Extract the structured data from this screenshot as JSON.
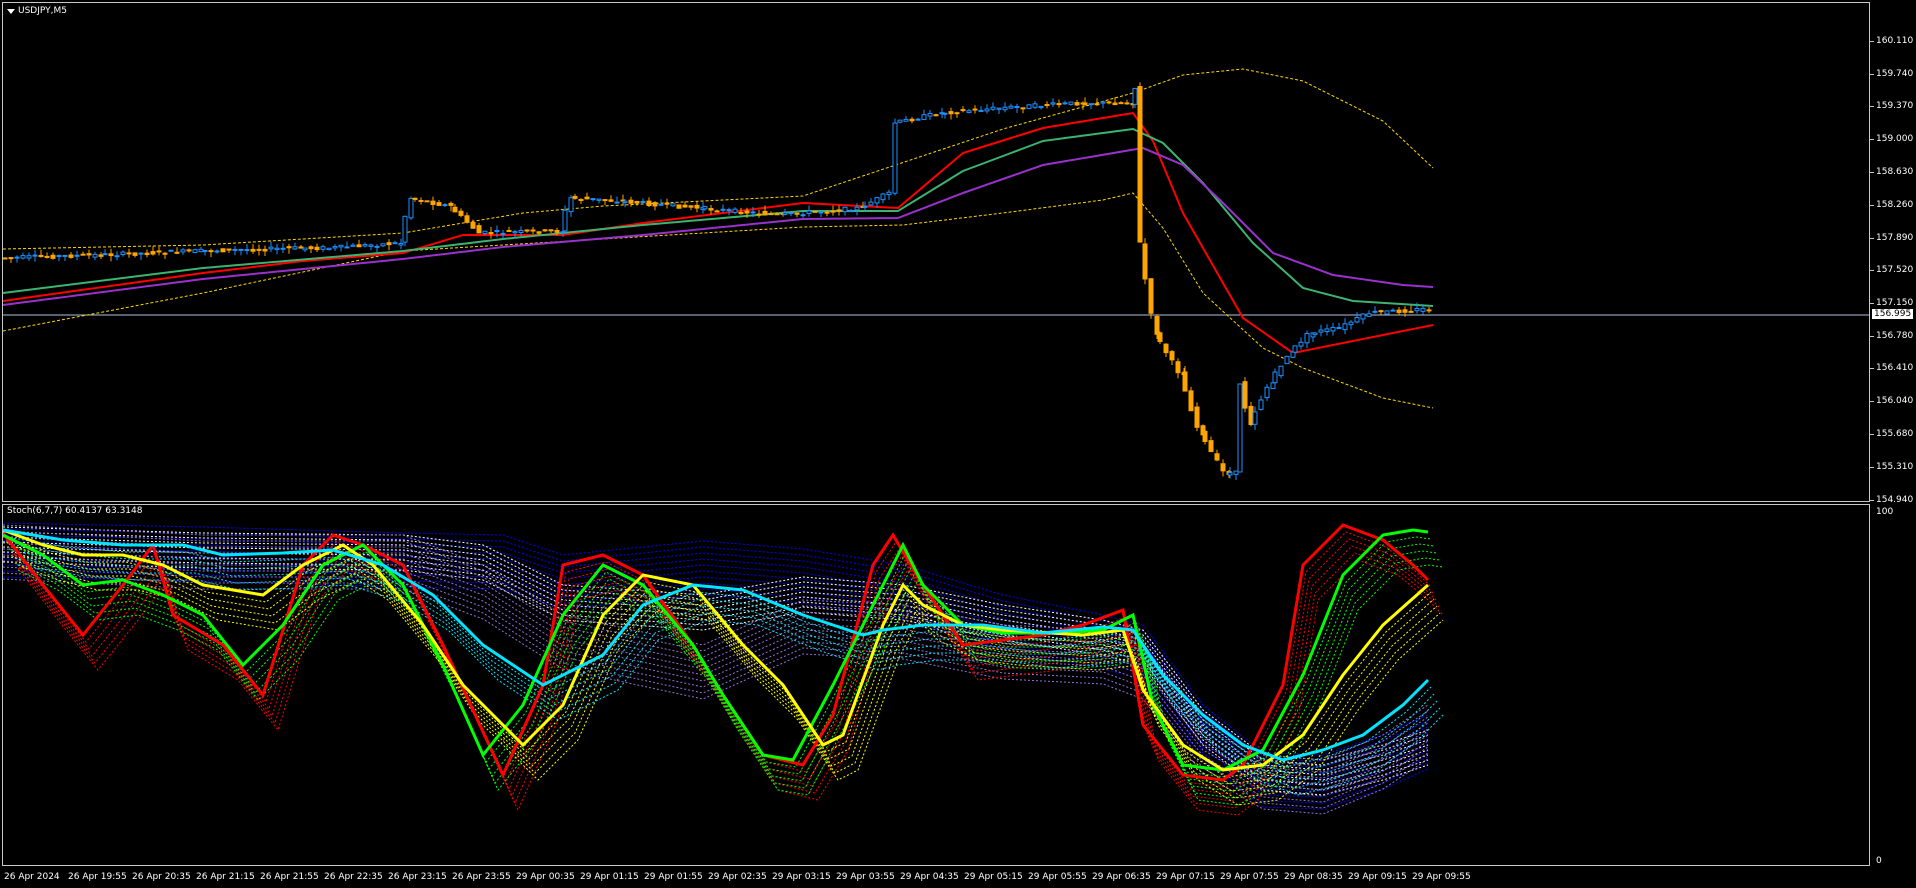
{
  "main": {
    "symbol_title": "USDJPY,M5",
    "current_price": "156.995",
    "price_ticks": [
      "160.110",
      "159.740",
      "159.370",
      "159.000",
      "158.630",
      "158.260",
      "157.890",
      "157.520",
      "157.150",
      "156.780",
      "156.410",
      "156.040",
      "155.680",
      "155.310",
      "154.940"
    ]
  },
  "sub": {
    "indicator_label": "Stoch(6,7,7) 60.4137 63.3148",
    "scale_top": "100",
    "scale_bottom": "0"
  },
  "time_axis": [
    "26 Apr 2024",
    "26 Apr 19:55",
    "26 Apr 20:35",
    "26 Apr 21:15",
    "26 Apr 21:55",
    "26 Apr 22:35",
    "26 Apr 23:15",
    "26 Apr 23:55",
    "29 Apr 00:35",
    "29 Apr 01:15",
    "29 Apr 01:55",
    "29 Apr 02:35",
    "29 Apr 03:15",
    "29 Apr 03:55",
    "29 Apr 04:35",
    "29 Apr 05:15",
    "29 Apr 05:55",
    "29 Apr 06:35",
    "29 Apr 07:15",
    "29 Apr 07:55",
    "29 Apr 08:35",
    "29 Apr 09:15",
    "29 Apr 09:55"
  ],
  "colors": {
    "bull": "#1e90ff",
    "bear": "#ffa500",
    "ma_red": "#ff0000",
    "ma_green": "#3cb371",
    "ma_purple": "#9932cc",
    "envelope": "#ffd700",
    "stoch_red": "#ff0000",
    "stoch_green": "#00ff00",
    "stoch_yellow": "#ffff00",
    "stoch_cyan": "#00e5ff",
    "stoch_purple": "#9370db",
    "stoch_blue": "#0000ff",
    "stoch_white": "#ffffff"
  }
}
